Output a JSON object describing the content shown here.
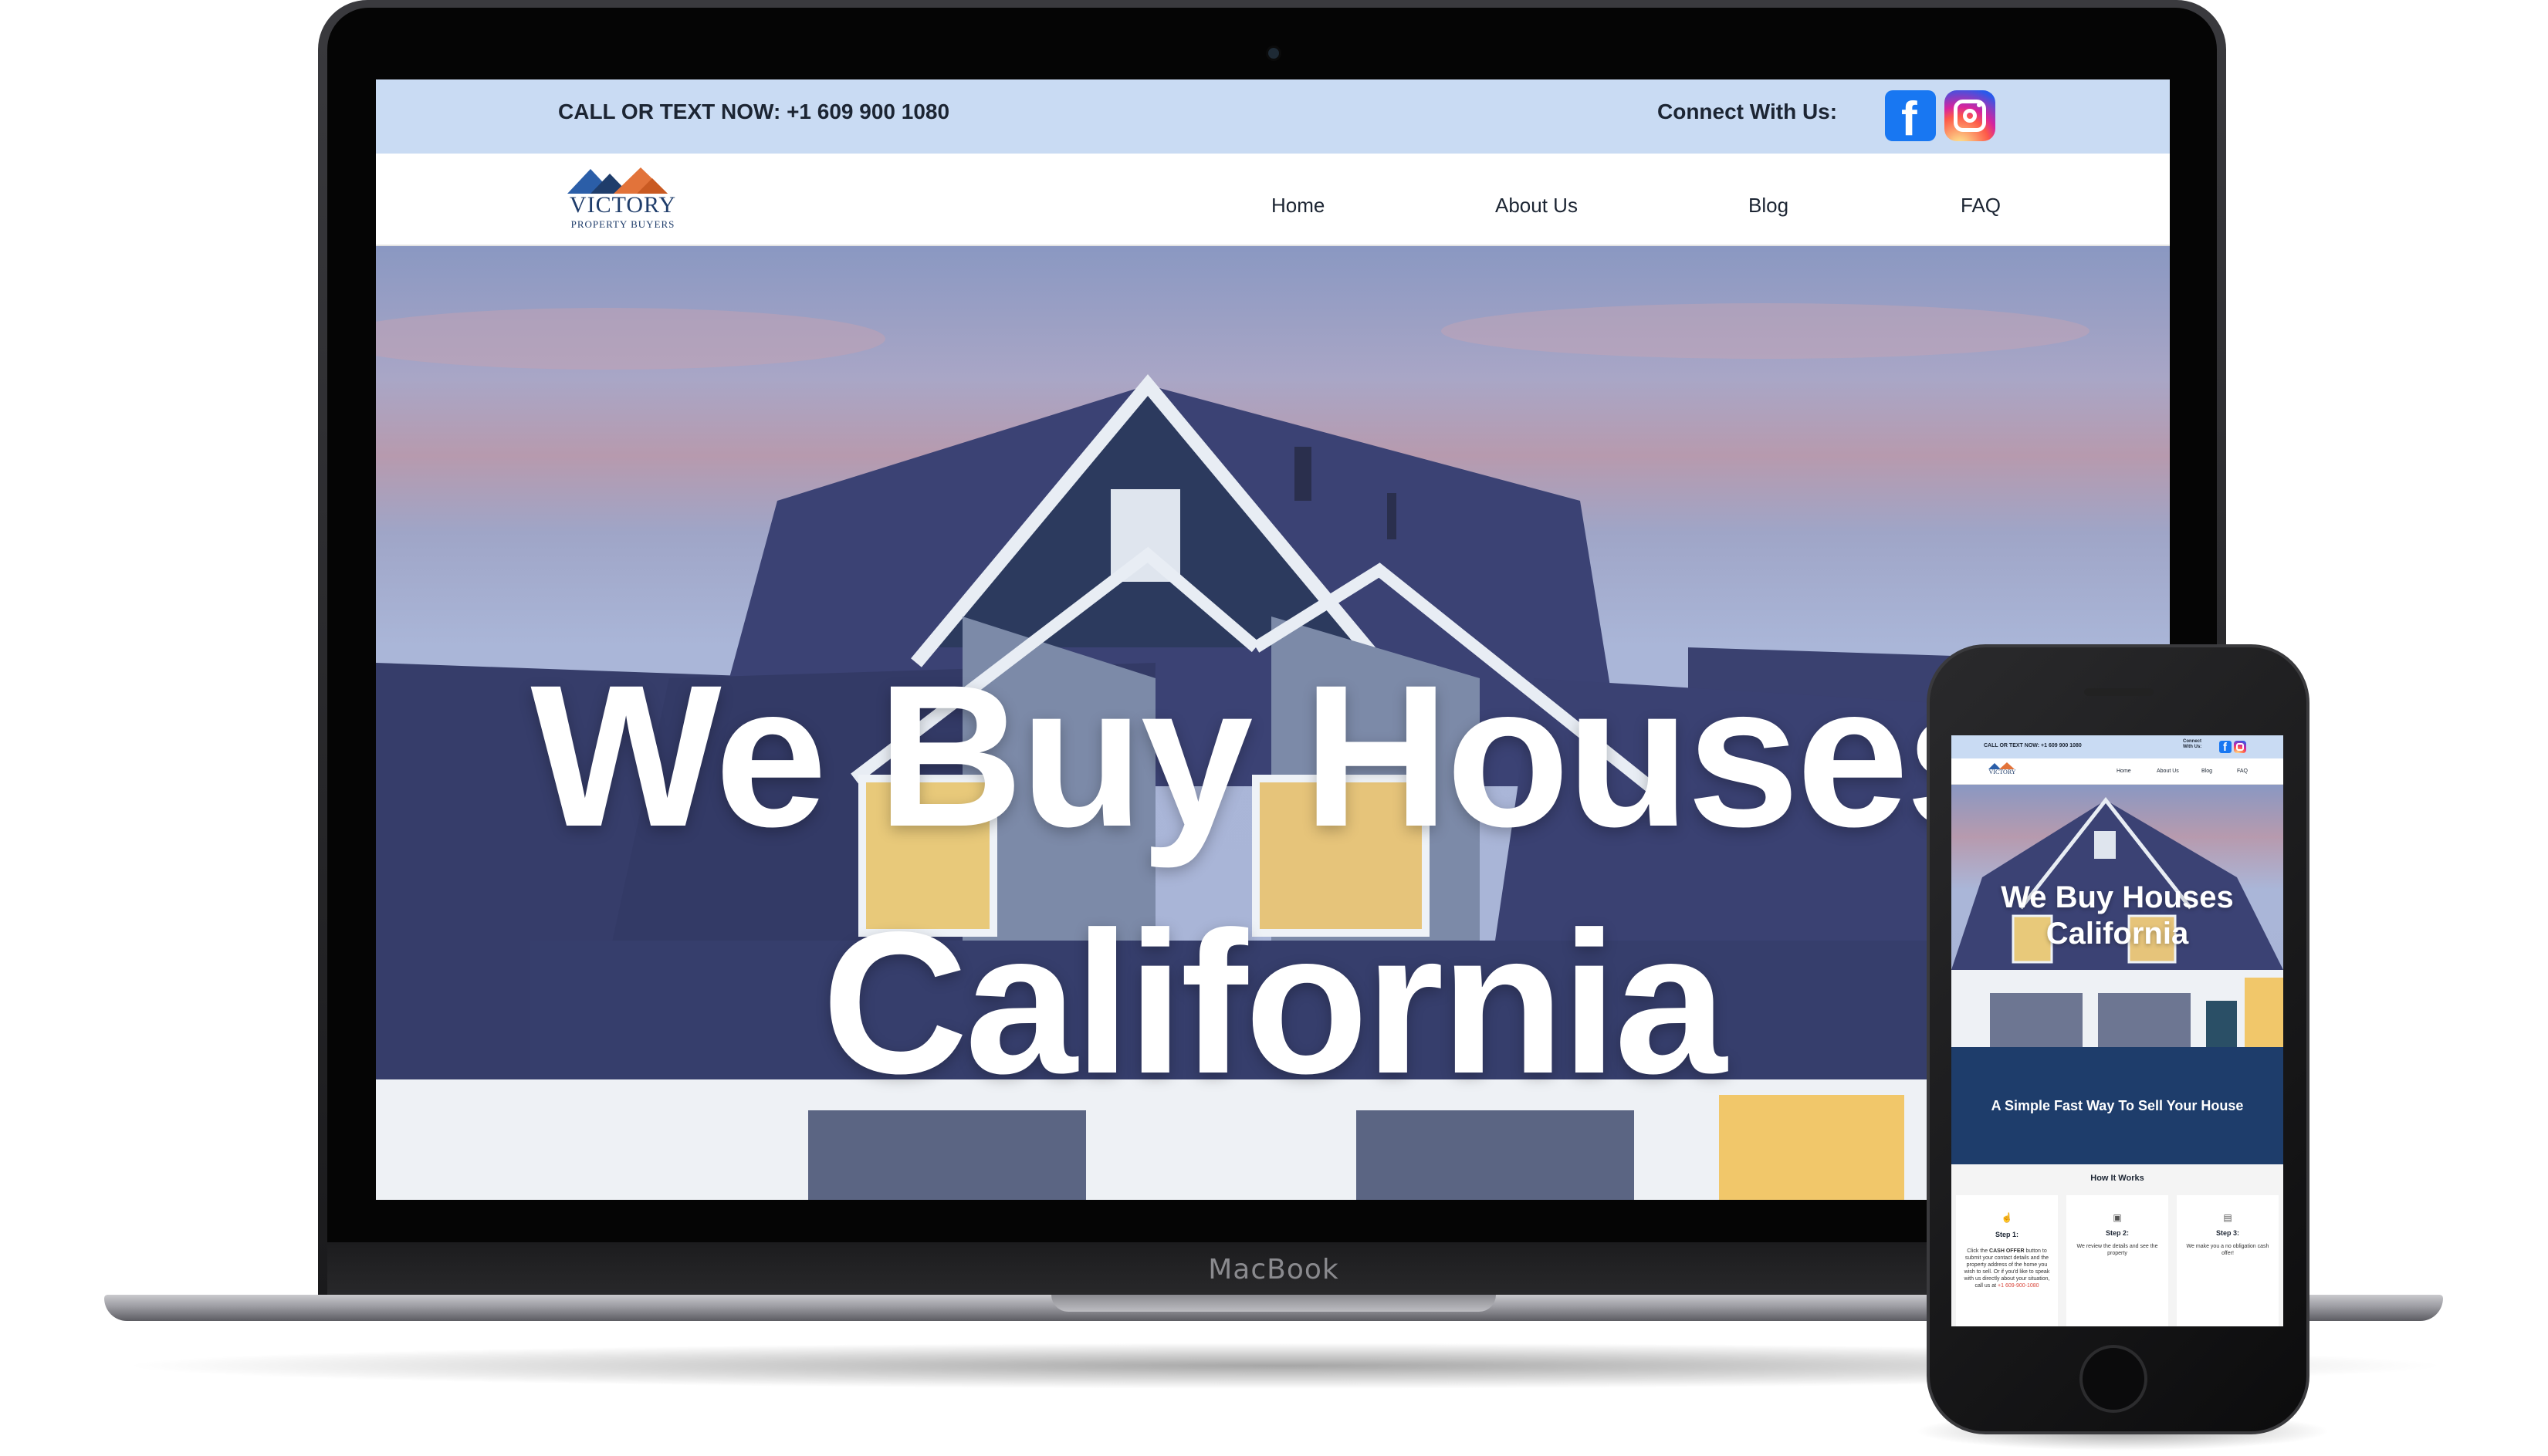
{
  "desktop": {
    "topbar": {
      "call_text": "CALL OR TEXT NOW: +1 609 900 1080",
      "connect_text": "Connect With Us:",
      "social": [
        {
          "name": "facebook",
          "icon": "facebook-icon",
          "color": "#1877f2"
        },
        {
          "name": "instagram",
          "icon": "instagram-icon",
          "color": "#d6249f"
        }
      ]
    },
    "logo": {
      "word": "VICTORY",
      "sub": "PROPERTY BUYERS"
    },
    "nav": [
      "Home",
      "About Us",
      "Blog",
      "FAQ"
    ],
    "hero": {
      "line1": "We Buy Houses",
      "line2": "California"
    }
  },
  "device_label": "MacBook",
  "mobile": {
    "topbar": {
      "call_text": "CALL OR TEXT NOW: +1 609 900 1080",
      "connect_text": "Connect With Us:"
    },
    "logo": {
      "word": "VICTORY"
    },
    "nav": [
      "Home",
      "About Us",
      "Blog",
      "FAQ"
    ],
    "hero": {
      "line1": "We Buy Houses",
      "line2": "California"
    },
    "band_text": "A Simple Fast Way To Sell Your House",
    "how_title": "How It Works",
    "steps": [
      {
        "label": "Step 1:",
        "desc_pre": "Click the ",
        "desc_bold": "CASH OFFER",
        "desc_post": " button to submit your contact details and the property address of the home you wish to sell. Or if you'd like to speak with us directly about your situation, call us at ",
        "desc_phone": "+1 609-900-1080"
      },
      {
        "label": "Step 2:",
        "desc": "We review the details and see the property"
      },
      {
        "label": "Step 3:",
        "desc": "We make you a no obligation cash offer!"
      }
    ]
  },
  "colors": {
    "topbar_bg": "#c9dbf3",
    "band_bg": "#1e3d6b",
    "text_dark": "#1c2533",
    "phone_link": "#d9463b"
  }
}
